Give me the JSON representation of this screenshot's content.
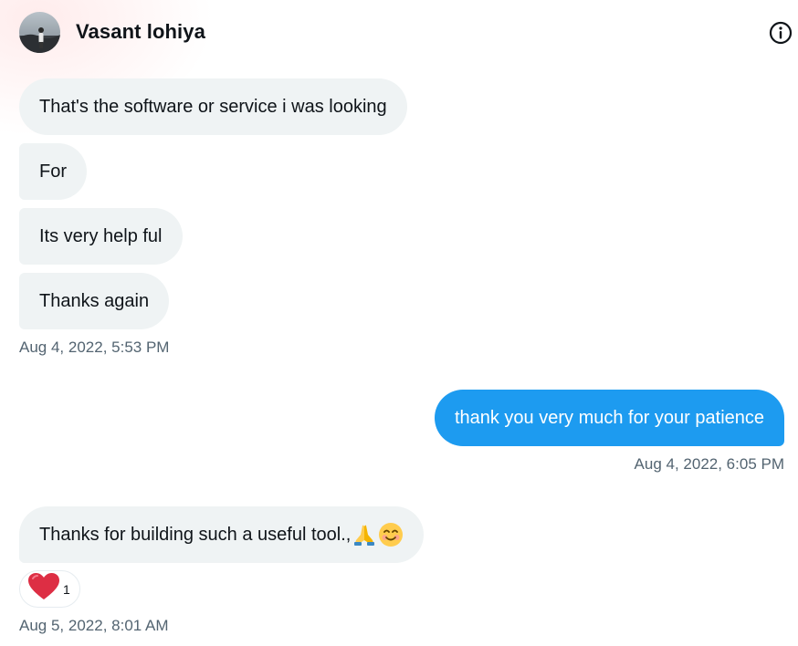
{
  "header": {
    "name": "Vasant lohiya",
    "avatar_icon": "profile-photo",
    "info_icon": "info-icon"
  },
  "messages": [
    {
      "direction": "incoming",
      "text": "That's the software or service i was looking"
    },
    {
      "direction": "incoming",
      "text": "For"
    },
    {
      "direction": "incoming",
      "text": "Its very help ful"
    },
    {
      "direction": "incoming",
      "text": "Thanks again"
    },
    {
      "direction": "outgoing",
      "text": "thank you very much for your patience"
    },
    {
      "direction": "incoming",
      "text": "Thanks for building such a useful tool.,",
      "emojis": [
        "folded-hands",
        "smiling-face"
      ]
    }
  ],
  "timestamps": [
    "Aug 4, 2022, 5:53 PM",
    "Aug 4, 2022, 6:05 PM",
    "Aug 5, 2022, 8:01 AM"
  ],
  "reaction": {
    "icon": "heart-icon",
    "count": "1"
  },
  "colors": {
    "incoming_bubble": "#eff3f4",
    "outgoing_bubble": "#1d9bf0",
    "timestamp_text": "#536471",
    "heart": "#f91880"
  }
}
